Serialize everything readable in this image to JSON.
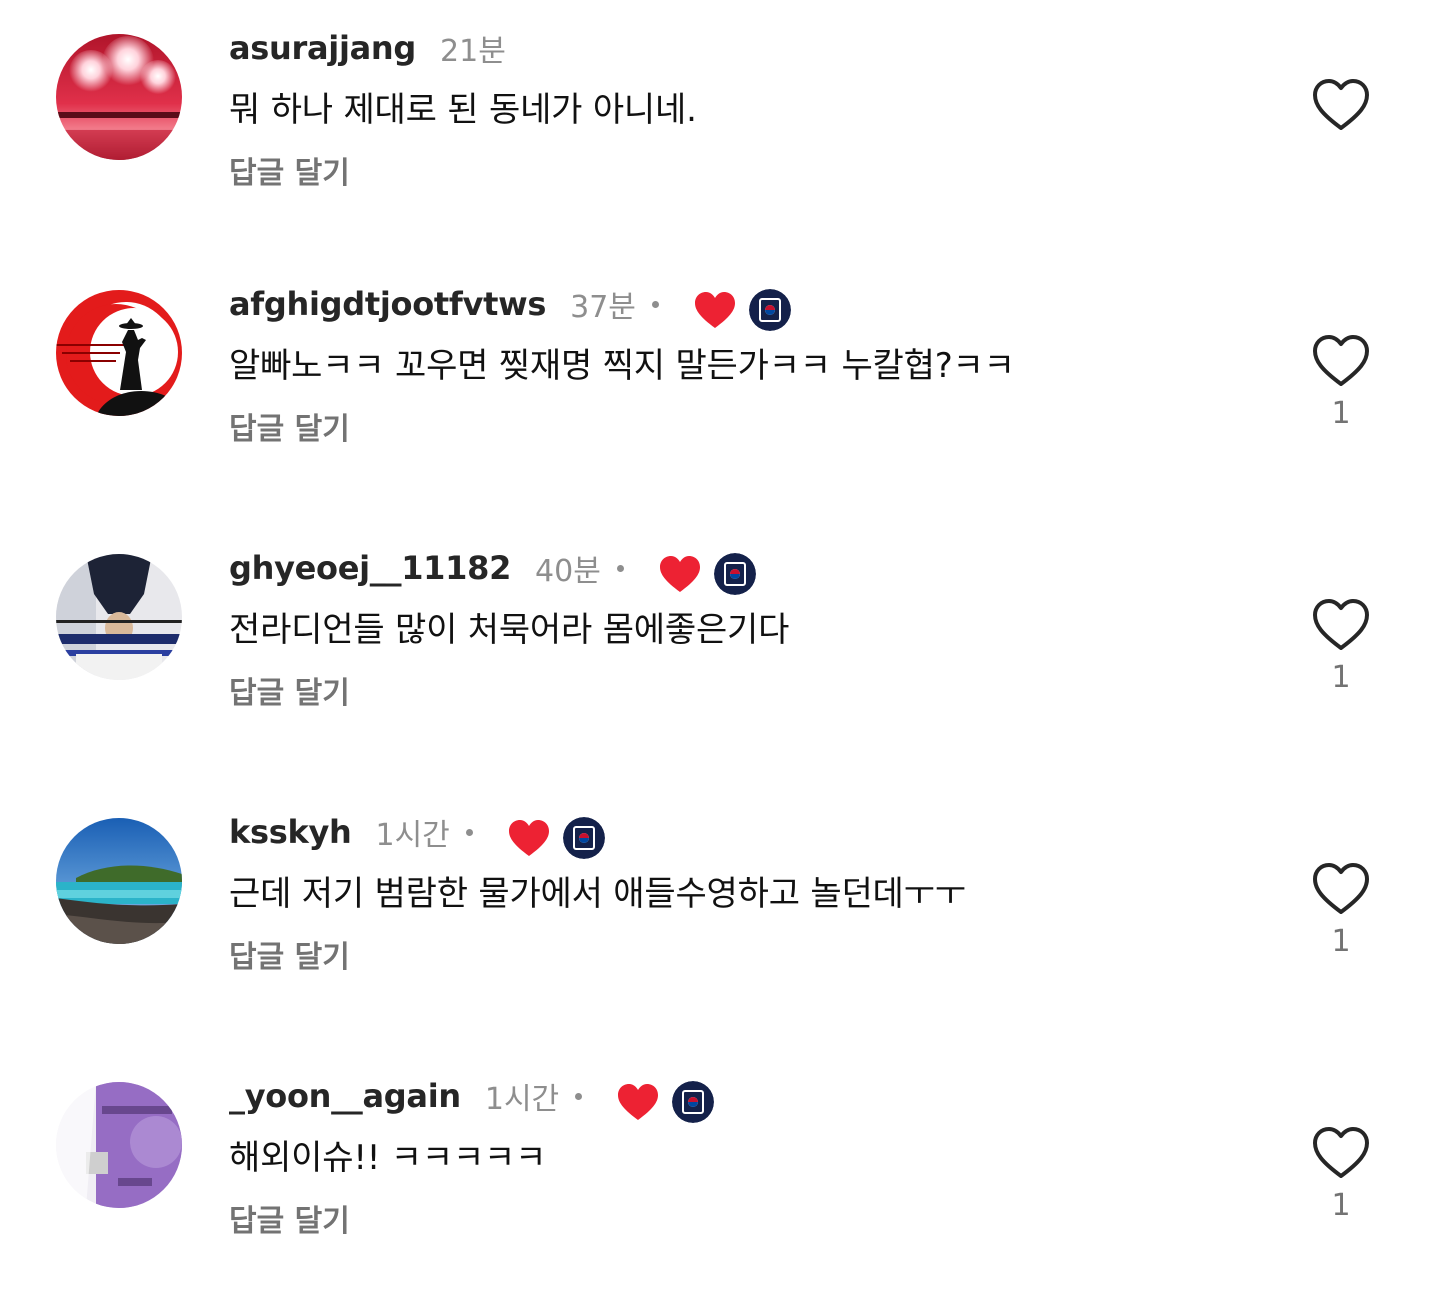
{
  "colors": {
    "username": "#262626",
    "time": "#8e8e8e",
    "reply": "#737373",
    "heart_red": "#ed2233",
    "creator_avatar_bg": "#14214a"
  },
  "icons": {
    "like": "heart-outline-icon",
    "creator_like": "heart-filled-icon",
    "creator_avatar": "creator-avatar-icon"
  },
  "comments": [
    {
      "username": "asurajjang",
      "time": "21분",
      "text": "뭐 하나 제대로 된 동네가 아니네.",
      "reply_label": "답글 달기",
      "like_count": "",
      "liked_by_creator": false
    },
    {
      "username": "afghigdtjootfvtws",
      "time": "37분",
      "text": "알빠노ㅋㅋ 꼬우면 찢재명 찍지 말든가ㅋㅋ 누칼협?ㅋㅋ",
      "reply_label": "답글 달기",
      "like_count": "1",
      "liked_by_creator": true
    },
    {
      "username": "ghyeoej__11182",
      "time": "40분",
      "text": "전라디언들 많이 처묵어라 몸에좋은기다",
      "reply_label": "답글 달기",
      "like_count": "1",
      "liked_by_creator": true
    },
    {
      "username": "ksskyh",
      "time": "1시간",
      "text": "근데 저기 범람한 물가에서 애들수영하고 놀던데ㅜㅜ",
      "reply_label": "답글 달기",
      "like_count": "1",
      "liked_by_creator": true
    },
    {
      "username": "_yoon__again",
      "time": "1시간",
      "text": "해외이슈!! ㅋㅋㅋㅋㅋ",
      "reply_label": "답글 달기",
      "like_count": "1",
      "liked_by_creator": true
    }
  ]
}
